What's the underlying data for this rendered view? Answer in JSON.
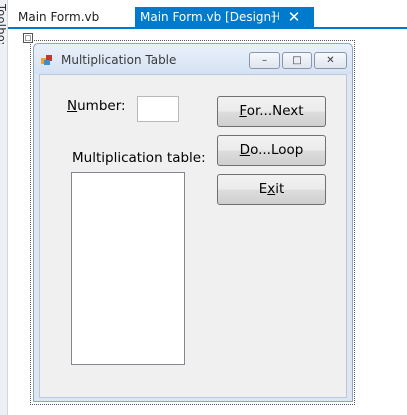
{
  "toolbox": {
    "label": "Toolbox"
  },
  "tabs": [
    {
      "label": "Main Form.vb",
      "active": false
    },
    {
      "label": "Main Form.vb [Design]",
      "active": true,
      "pin_icon": "pin-icon",
      "close_icon": "close-icon"
    }
  ],
  "colors": {
    "accent": "#007acc",
    "form_back": "#f0f0f0"
  },
  "form": {
    "title": "Multiplication Table",
    "title_icon": "form-icon",
    "number_label": {
      "mnemonic": "N",
      "rest": "umber:"
    },
    "number_value": "",
    "table_label": "Multiplication table:",
    "list_items": [],
    "buttons": [
      {
        "mnemonic": "F",
        "rest": "or...Next"
      },
      {
        "mnemonic": "D",
        "rest": "o...Loop"
      },
      {
        "pre": "E",
        "mnemonic": "x",
        "rest": "it"
      }
    ]
  }
}
